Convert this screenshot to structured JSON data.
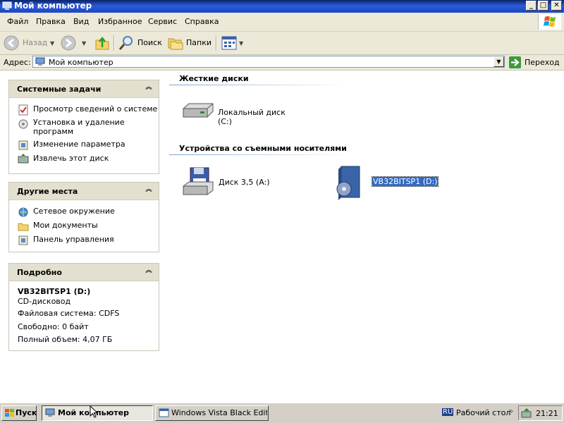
{
  "window": {
    "title": "Мой компьютер",
    "icon": "my-computer-icon"
  },
  "caption_buttons": {
    "minimize": "_",
    "maximize": "□",
    "close": "✕"
  },
  "menu": [
    "Файл",
    "Правка",
    "Вид",
    "Избранное",
    "Сервис",
    "Справка"
  ],
  "toolbar": {
    "back": "Назад",
    "search": "Поиск",
    "folders": "Папки"
  },
  "address": {
    "label": "Адрес:",
    "value": "Мой компьютер",
    "go": "Переход"
  },
  "left_panel": {
    "system_tasks": {
      "title": "Системные задачи",
      "items": [
        "Просмотр сведений о системе",
        "Установка и удаление программ",
        "Изменение параметра",
        "Извлечь этот диск"
      ]
    },
    "other_places": {
      "title": "Другие места",
      "items": [
        "Сетевое окружение",
        "Мои документы",
        "Панель управления"
      ]
    },
    "details": {
      "title": "Подробно",
      "name": "VB32BITSP1 (D:)",
      "type": "CD-дисковод",
      "filesystem": "Файловая система: CDFS",
      "free": "Свободно: 0 байт",
      "total": "Полный объем: 4,07 ГБ"
    }
  },
  "content": {
    "hard_drives": {
      "title": "Жесткие диски",
      "items": [
        "Локальный диск (C:)"
      ]
    },
    "removable": {
      "title": "Устройства со съемными носителями",
      "items": [
        "Диск 3,5 (A:)",
        "VB32BITSP1 (D:)"
      ]
    },
    "selected_item": "VB32BITSP1 (D:)"
  },
  "taskbar": {
    "start": "Пуск",
    "tasks": [
      "Мой компьютер",
      "Windows Vista Black Editi..."
    ],
    "lang": "RU",
    "desktop": "Рабочий стол",
    "clock": "21:21"
  },
  "colors": {
    "titlebar": "#1c48c2",
    "selection": "#316ac5",
    "panel_header": "#e3e0cf"
  }
}
